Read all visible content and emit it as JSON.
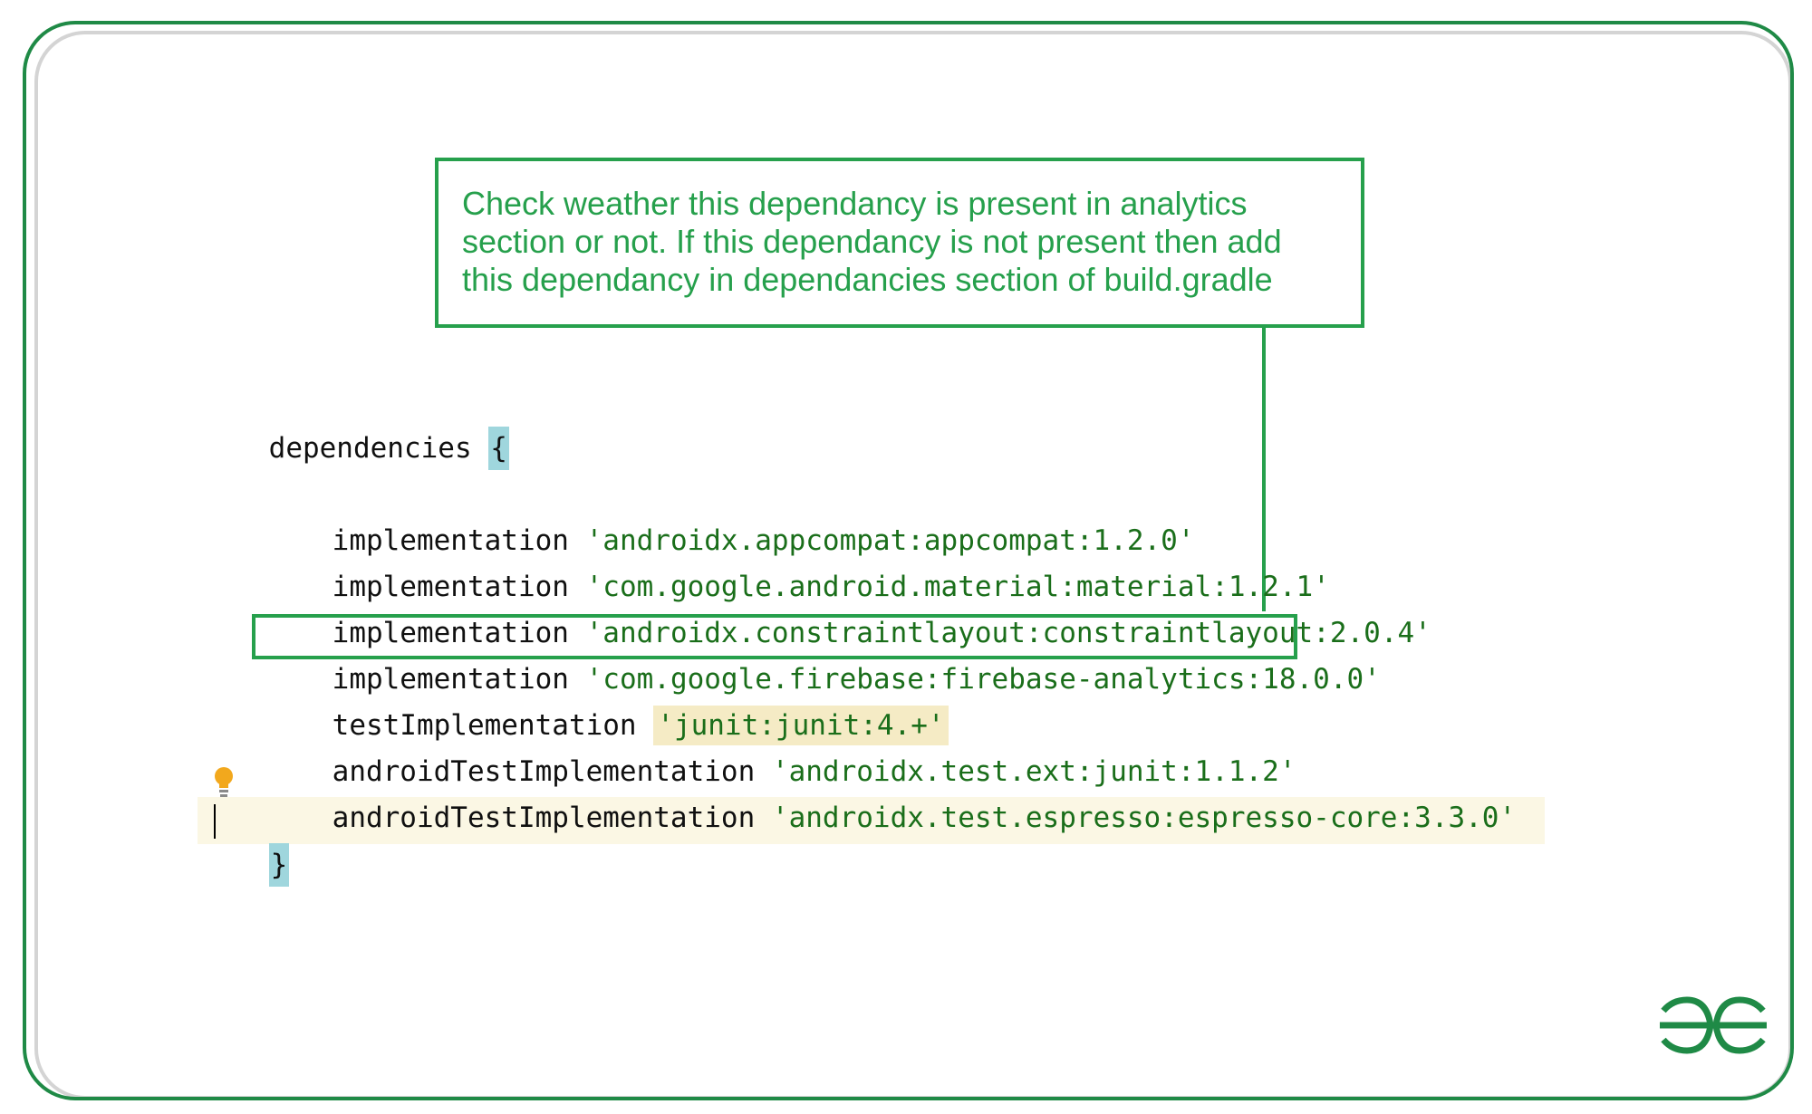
{
  "callout": {
    "lines": [
      "Check weather this dependancy is present in analytics",
      "section or not. If this dependancy is not present then add",
      "this dependancy in dependancies section of build.gradle"
    ]
  },
  "code": {
    "header_keyword": "dependencies",
    "open_brace": "{",
    "close_brace": "}",
    "lines": [
      {
        "keyword": "implementation",
        "value": "'androidx.appcompat:appcompat:1.2.0'"
      },
      {
        "keyword": "implementation",
        "value": "'com.google.android.material:material:1.2.1'"
      },
      {
        "keyword": "implementation",
        "value": "'androidx.constraintlayout:constraintlayout:2.0.4'"
      },
      {
        "keyword": "implementation",
        "value": "'com.google.firebase:firebase-analytics:18.0.0'"
      },
      {
        "keyword": "testImplementation",
        "value": "'junit:junit:4.+'"
      },
      {
        "keyword": "androidTestImplementation",
        "value": "'androidx.test.ext:junit:1.1.2'"
      },
      {
        "keyword": "androidTestImplementation",
        "value": "'androidx.test.espresso:espresso-core:3.3.0'"
      }
    ]
  },
  "colors": {
    "brand_green": "#1f8a46",
    "annotation_green": "#26a04c",
    "string_green": "#1a6e1a",
    "brace_highlight": "#9fd6dd",
    "string_highlight": "#f5ebc5"
  },
  "icons": {
    "bulb": "lightbulb-icon",
    "logo": "gfg-logo"
  }
}
